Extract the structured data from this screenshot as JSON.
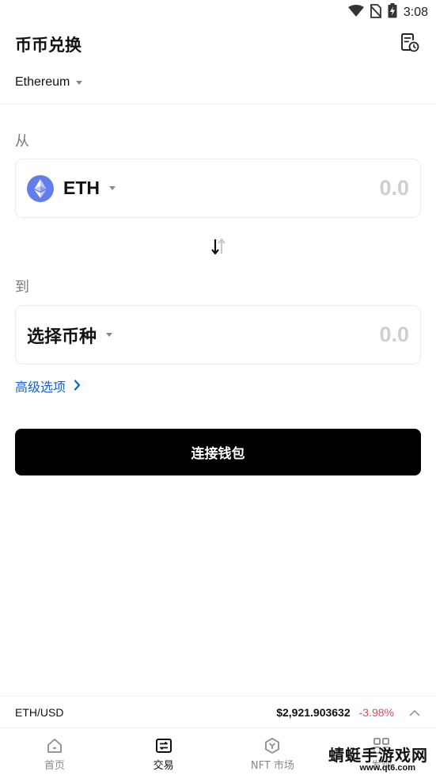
{
  "status_bar": {
    "time": "3:08",
    "icons": [
      "wifi-icon",
      "no-sim-icon",
      "battery-charging-icon"
    ]
  },
  "header": {
    "title": "币币兑换",
    "history_icon": "history-icon"
  },
  "network": {
    "selected": "Ethereum"
  },
  "from": {
    "label": "从",
    "token_symbol": "ETH",
    "token_icon": "ethereum-logo-icon",
    "amount_placeholder": "0.0"
  },
  "swap_icon": "swap-arrows-icon",
  "to": {
    "label": "到",
    "token_placeholder": "选择币种",
    "amount_placeholder": "0.0"
  },
  "advanced": {
    "label": "高级选项"
  },
  "connect_button": {
    "label": "连接钱包"
  },
  "ticker": {
    "pair": "ETH/USD",
    "price": "$2,921.903632",
    "change": "-3.98%"
  },
  "bottom_nav": {
    "items": [
      {
        "label": "首页",
        "icon": "home-icon",
        "active": false
      },
      {
        "label": "交易",
        "icon": "trade-icon",
        "active": true
      },
      {
        "label": "NFT 市场",
        "icon": "nft-market-icon",
        "active": false
      },
      {
        "label": "发现",
        "icon": "grid-icon",
        "active": false
      }
    ]
  },
  "watermark": {
    "main": "蜻蜓手游戏网",
    "url": "www.qt6.com"
  },
  "colors": {
    "accent_link": "#1560c9",
    "negative_change": "#e04b5d",
    "eth_logo": "#627eea",
    "primary_button": "#000000"
  }
}
